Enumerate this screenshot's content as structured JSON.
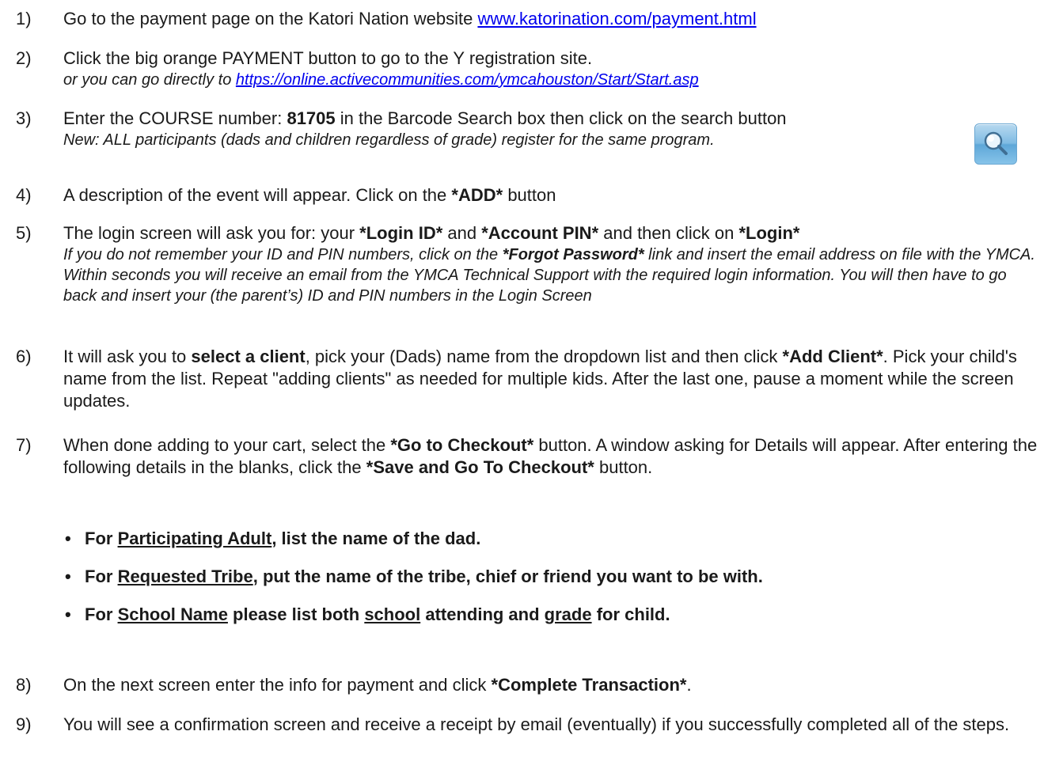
{
  "steps": [
    {
      "number": "1)",
      "text_before": "Go to the payment page on the Katori Nation website ",
      "link": "www.katorination.com/payment.html"
    },
    {
      "number": "2)",
      "text": "Click the big orange PAYMENT button to go to the Y registration site.",
      "sub_before": "or you can go directly to ",
      "sub_link": "https://online.activecommunities.com/ymcahouston/Start/Start.asp"
    },
    {
      "number": "3)",
      "text_before": "Enter the COURSE number:  ",
      "bold": "81705",
      "text_after": " in the Barcode Search box then click on the search button",
      "sub": "New: ALL participants (dads and children regardless of grade) register for the same program."
    },
    {
      "number": "4)",
      "text_before": "A description of the event will appear. Click on the ",
      "bold": "*ADD*",
      "text_after": " button"
    },
    {
      "number": "5)",
      "t1": "The login screen will ask you for: your ",
      "b1": "*Login ID*",
      "t2": " and ",
      "b2": "*Account PIN*",
      "t3": " and then click on ",
      "b3": "*Login*",
      "sub_before": "If you do not remember your ID and PIN numbers, click on the ",
      "sub_bold": "*Forgot Password*",
      "sub_after": " link and insert the email address on file with the YMCA.  Within seconds you will receive an email from the YMCA Technical Support with the required login information.  You will then have to go back and insert your (the parent’s) ID and PIN numbers in the Login Screen"
    },
    {
      "number": "6)",
      "t1": "It will ask you to ",
      "b1": "select a client",
      "t2": ", pick your (Dads) name from the dropdown list and then click ",
      "b2": "*Add Client*",
      "t3": ". Pick your child's name from the list. Repeat \"adding clients\" as needed for multiple kids. After the last one, pause a moment while the screen updates."
    },
    {
      "number": "7)",
      "t1": "When done adding to your cart, select the ",
      "b1": "*Go to Checkout*",
      "t2": " button.  A window asking for Details will appear.  After entering the following details in the blanks, click the ",
      "b2": "*Save and Go To Checkout*",
      "t3": " button."
    },
    {
      "number": "8)",
      "text_before": "On the next screen enter the info for payment and click ",
      "bold": "*Complete Transaction*",
      "text_after": "."
    },
    {
      "number": "9)",
      "text": "You will see a confirmation screen and receive a receipt by email (eventually) if you successfully completed all of the steps."
    }
  ],
  "bullets": [
    {
      "dot": "•",
      "p1": "For ",
      "u1": "Participating Adult",
      "p2": ", list the name of the dad."
    },
    {
      "dot": "•",
      "p1": "For ",
      "u1": "Requested Tribe",
      "p2": ", put the name of the tribe, chief or friend you want to be with."
    },
    {
      "dot": "•",
      "p1": "For ",
      "u1": "School Name",
      "p2": " please list both ",
      "u2": "school",
      "p3": " attending and ",
      "u3": "grade",
      "p4": " for child."
    }
  ],
  "icons": {
    "search": "search-icon"
  },
  "colors": {
    "link": "#0000ee",
    "search_button": "#7fbbe3"
  }
}
